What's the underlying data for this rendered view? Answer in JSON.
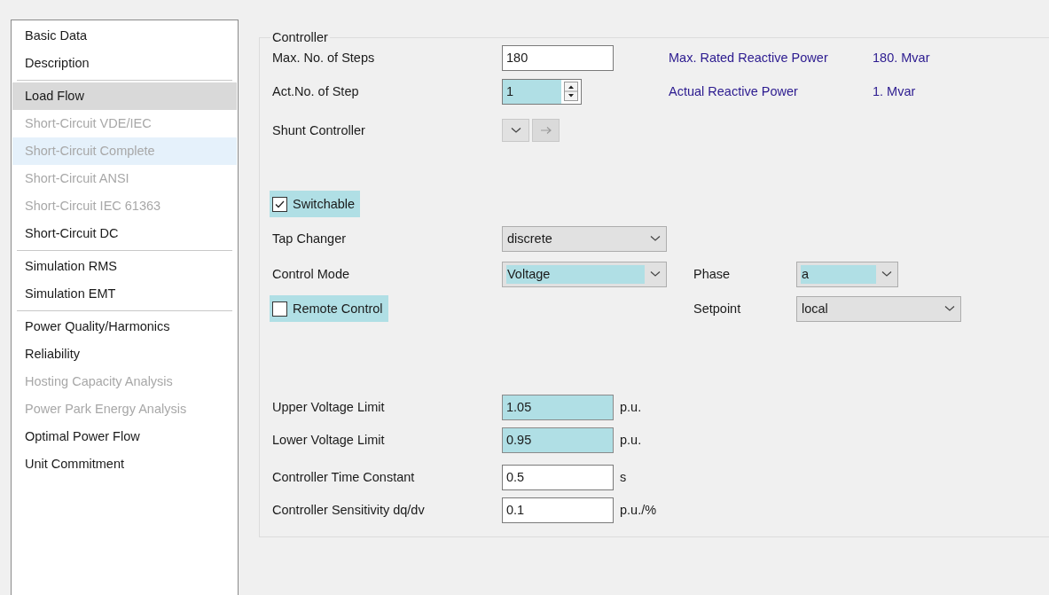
{
  "sidebar": {
    "groups": [
      {
        "items": [
          {
            "label": "Basic Data",
            "selected": false,
            "disabled": false,
            "hovered": false
          },
          {
            "label": "Description",
            "selected": false,
            "disabled": false,
            "hovered": false
          }
        ]
      },
      {
        "items": [
          {
            "label": "Load Flow",
            "selected": true,
            "disabled": false,
            "hovered": false
          },
          {
            "label": "Short-Circuit VDE/IEC",
            "selected": false,
            "disabled": true,
            "hovered": false
          },
          {
            "label": "Short-Circuit Complete",
            "selected": false,
            "disabled": true,
            "hovered": true
          },
          {
            "label": "Short-Circuit ANSI",
            "selected": false,
            "disabled": true,
            "hovered": false
          },
          {
            "label": "Short-Circuit IEC 61363",
            "selected": false,
            "disabled": true,
            "hovered": false
          },
          {
            "label": "Short-Circuit DC",
            "selected": false,
            "disabled": false,
            "hovered": false
          }
        ]
      },
      {
        "items": [
          {
            "label": "Simulation RMS",
            "selected": false,
            "disabled": false,
            "hovered": false
          },
          {
            "label": "Simulation EMT",
            "selected": false,
            "disabled": false,
            "hovered": false
          }
        ]
      },
      {
        "items": [
          {
            "label": "Power Quality/Harmonics",
            "selected": false,
            "disabled": false,
            "hovered": false
          },
          {
            "label": "Reliability",
            "selected": false,
            "disabled": false,
            "hovered": false
          },
          {
            "label": "Hosting Capacity Analysis",
            "selected": false,
            "disabled": true,
            "hovered": false
          },
          {
            "label": "Power Park Energy Analysis",
            "selected": false,
            "disabled": true,
            "hovered": false
          },
          {
            "label": "Optimal Power Flow",
            "selected": false,
            "disabled": false,
            "hovered": false
          },
          {
            "label": "Unit Commitment",
            "selected": false,
            "disabled": false,
            "hovered": false
          }
        ]
      }
    ]
  },
  "controller": {
    "title": "Controller",
    "rows": [
      {
        "kind": "text",
        "label": "Max. No. of Steps",
        "value": "180",
        "highlighted": false,
        "info_label": "Max. Rated Reactive Power",
        "info_value": "180. Mvar"
      },
      {
        "kind": "spin",
        "label": "Act.No. of Step",
        "value": "1",
        "highlighted": true,
        "info_label": "Actual Reactive Power",
        "info_value": "1. Mvar"
      },
      {
        "kind": "buttons",
        "label": "Shunt Controller"
      },
      {
        "kind": "checkbox",
        "label": "Switchable",
        "checked": true
      },
      {
        "kind": "dropdown",
        "label": "Tap Changer",
        "value": "discrete",
        "highlighted": false
      },
      {
        "kind": "dropdown",
        "label": "Control Mode",
        "value": "Voltage",
        "highlighted": true,
        "side": {
          "label": "Phase",
          "value": "a",
          "highlighted": true,
          "wide": false
        }
      },
      {
        "kind": "checkbox",
        "label": "Remote Control",
        "checked": false,
        "side": {
          "label": "Setpoint",
          "value": "local",
          "highlighted": false,
          "wide": true
        }
      },
      {
        "kind": "text",
        "label": "Upper Voltage Limit",
        "value": "1.05",
        "highlighted": true,
        "unit": "p.u."
      },
      {
        "kind": "text",
        "label": "Lower Voltage Limit",
        "value": "0.95",
        "highlighted": true,
        "unit": "p.u."
      },
      {
        "kind": "text",
        "label": "Controller Time Constant",
        "value": "0.5",
        "highlighted": false,
        "unit": "s"
      },
      {
        "kind": "text",
        "label": "Controller Sensitivity dq/dv",
        "value": "0.1",
        "highlighted": false,
        "unit": "p.u./%"
      }
    ]
  }
}
